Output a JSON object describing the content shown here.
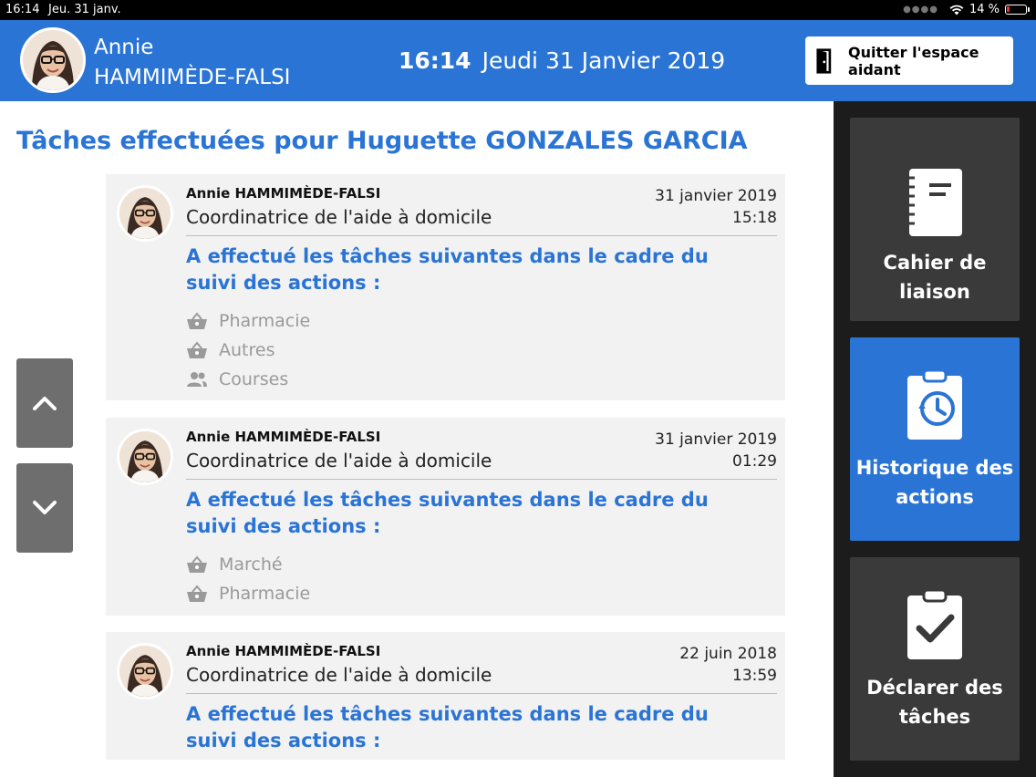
{
  "status_bar": {
    "time": "16:14",
    "date": "Jeu. 31 janv.",
    "battery": "14 %"
  },
  "header": {
    "user_first": "Annie",
    "user_last": "HAMMIMÈDE-FALSI",
    "time": "16:14",
    "date": "Jeudi 31 Janvier 2019",
    "quit_label": "Quitter l'espace aidant"
  },
  "page_title": "Tâches effectuées pour Huguette GONZALES GARCIA",
  "cards": [
    {
      "author": "Annie HAMMIMÈDE-FALSI",
      "role": "Coordinatrice de l'aide à domicile",
      "date": "31 janvier 2019",
      "time": "15:18",
      "heading": "A effectué les tâches suivantes dans le cadre du suivi des actions :",
      "tasks": [
        {
          "icon": "basket-icon",
          "label": "Pharmacie"
        },
        {
          "icon": "basket-icon",
          "label": "Autres"
        },
        {
          "icon": "people-icon",
          "label": "Courses"
        }
      ]
    },
    {
      "author": "Annie HAMMIMÈDE-FALSI",
      "role": "Coordinatrice de l'aide à domicile",
      "date": "31 janvier 2019",
      "time": "01:29",
      "heading": "A effectué les tâches suivantes dans le cadre du suivi des actions :",
      "tasks": [
        {
          "icon": "basket-icon",
          "label": "Marché"
        },
        {
          "icon": "basket-icon",
          "label": "Pharmacie"
        }
      ]
    },
    {
      "author": "Annie HAMMIMÈDE-FALSI",
      "role": "Coordinatrice de l'aide à domicile",
      "date": "22 juin 2018",
      "time": "13:59",
      "heading": "A effectué les tâches suivantes dans le cadre du suivi des actions :",
      "tasks": []
    }
  ],
  "sidebar": [
    {
      "label_1": "Cahier de liaison",
      "label_2": "",
      "active": false,
      "icon": "notebook-icon"
    },
    {
      "label_1": "Historique des",
      "label_2": "actions",
      "active": true,
      "icon": "history-icon"
    },
    {
      "label_1": "Déclarer des",
      "label_2": "tâches",
      "active": false,
      "icon": "clipboard-check-icon"
    }
  ],
  "colors": {
    "primary": "#2a74d5",
    "sidebar_bg": "#1c1c1c",
    "sidebar_btn": "#3a3a3a"
  }
}
